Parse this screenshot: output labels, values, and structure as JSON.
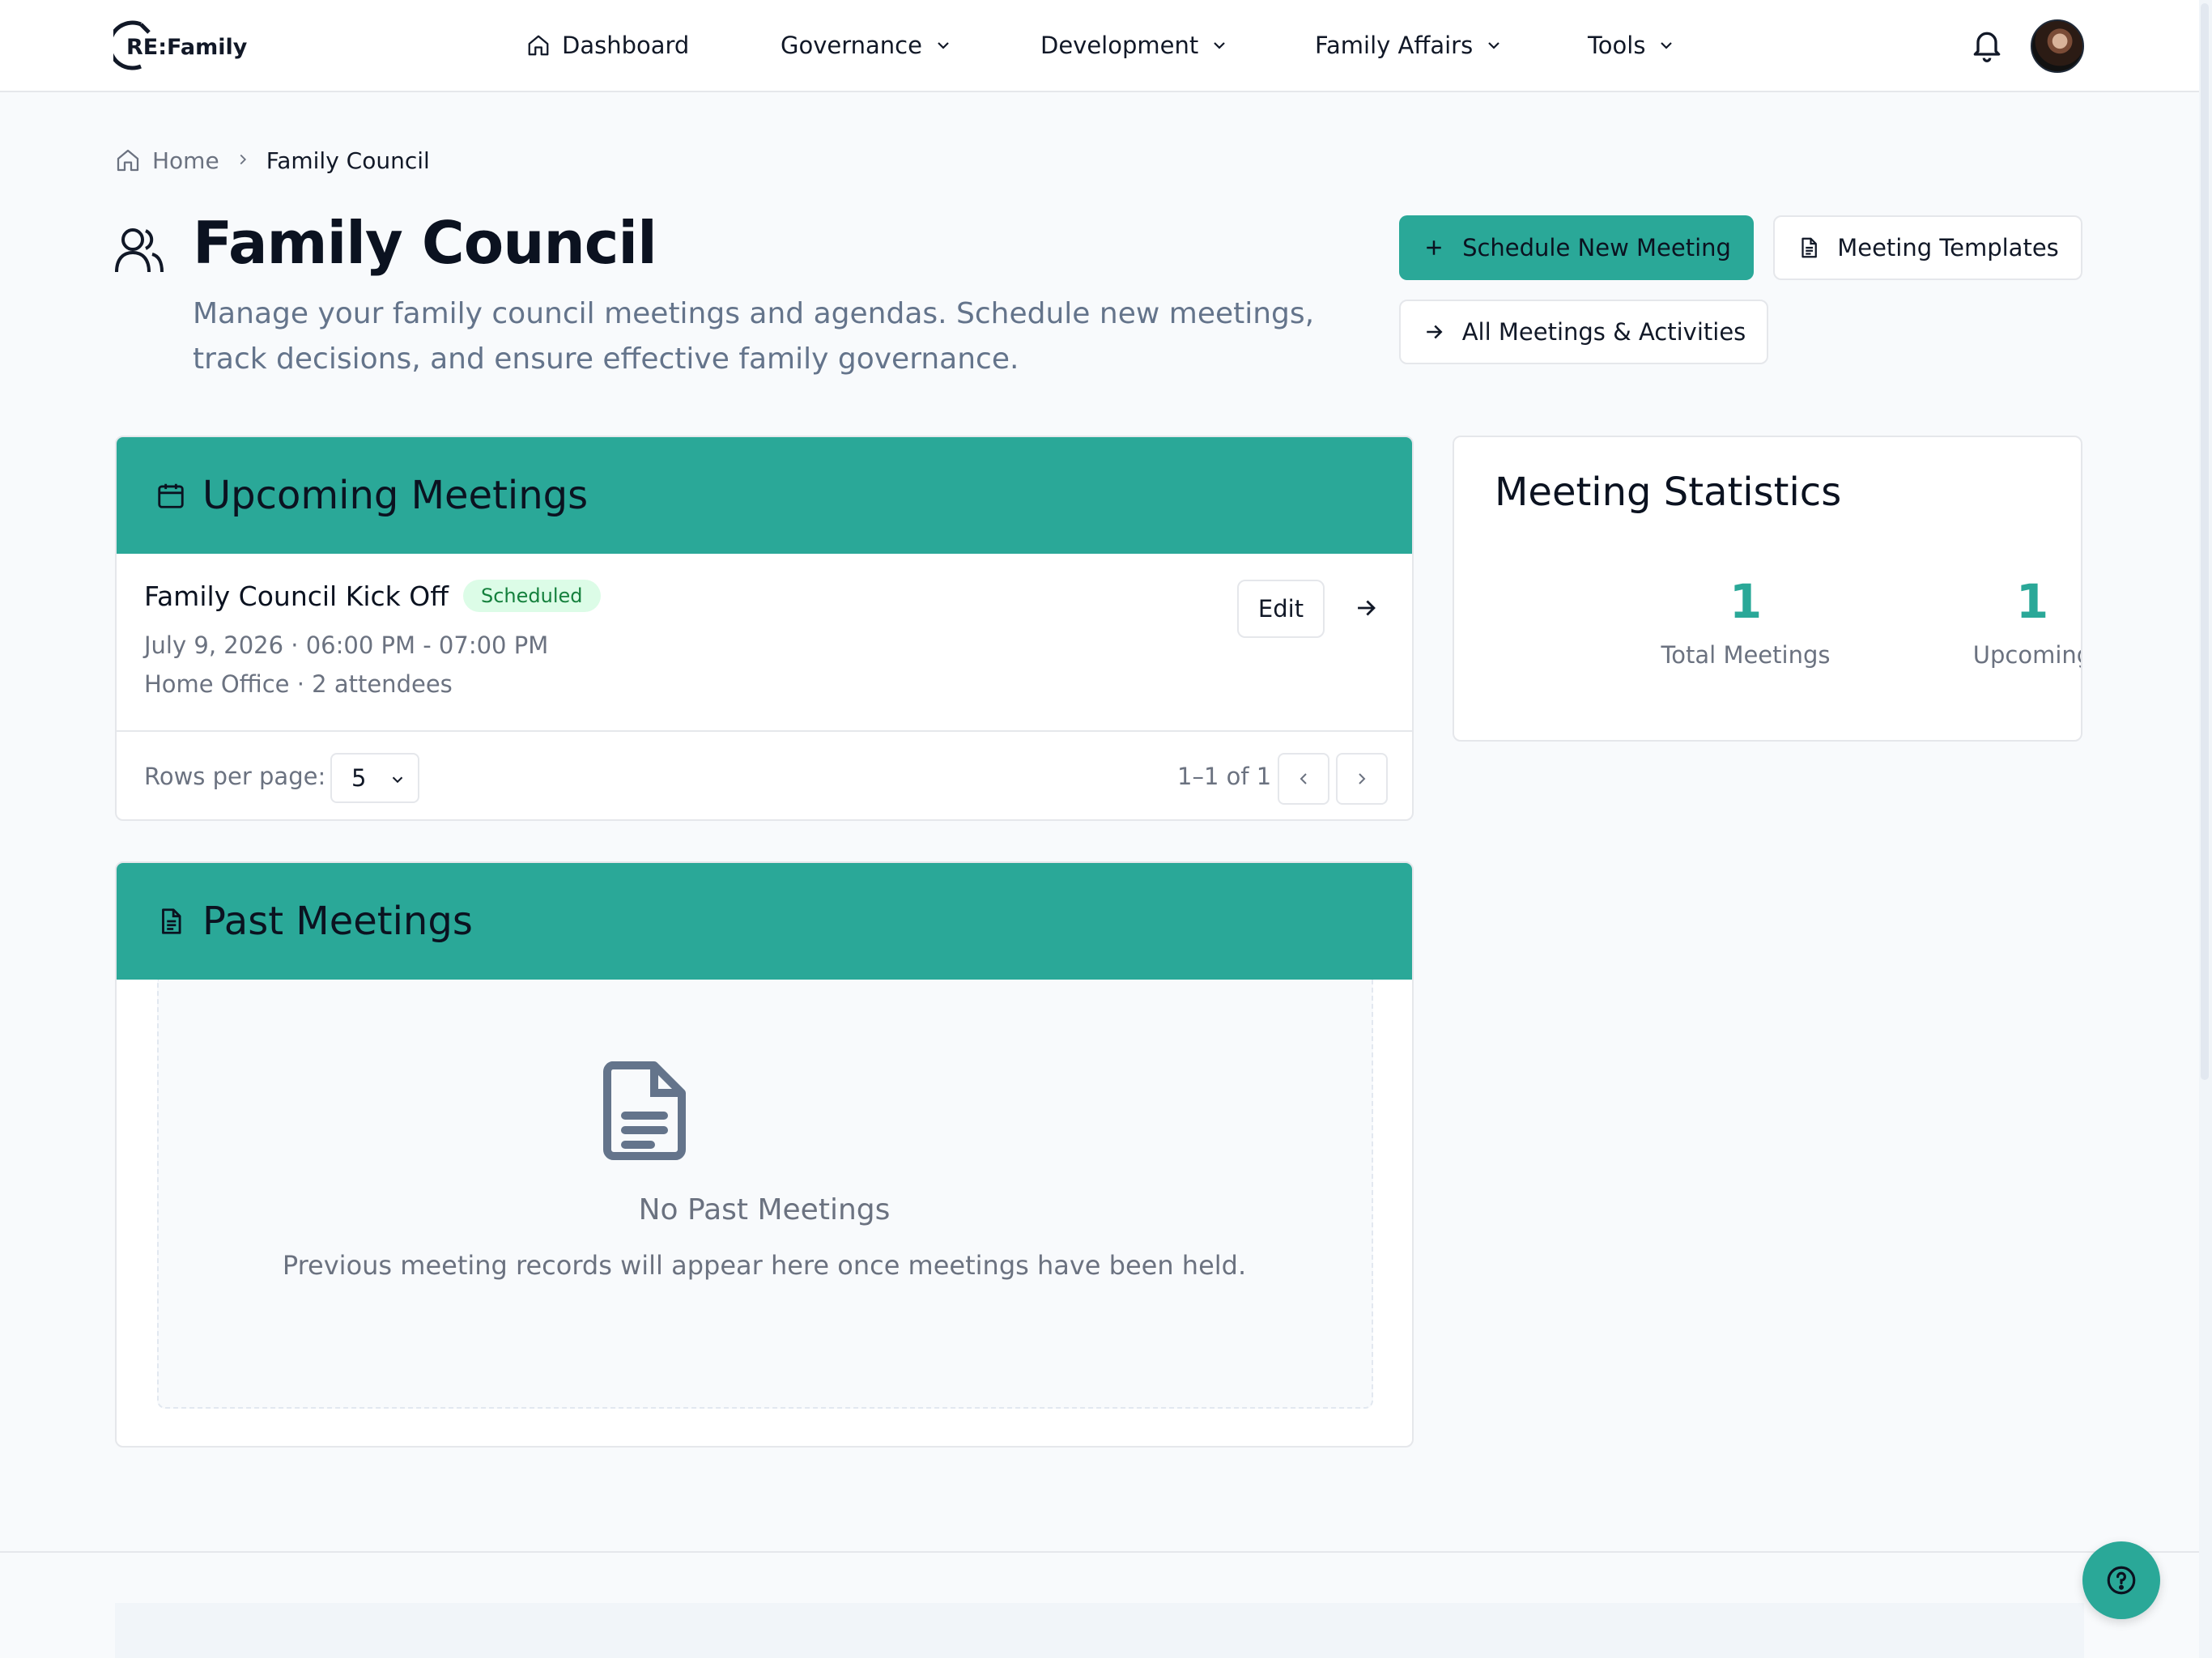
{
  "brand": {
    "logo_text": "RE:Family"
  },
  "nav": {
    "items": [
      {
        "label": "Dashboard"
      },
      {
        "label": "Governance"
      },
      {
        "label": "Development"
      },
      {
        "label": "Family Affairs"
      },
      {
        "label": "Tools"
      }
    ]
  },
  "breadcrumb": {
    "home": "Home",
    "current": "Family Council"
  },
  "header": {
    "title": "Family Council",
    "subtitle": "Manage your family council meetings and agendas. Schedule new meetings, track decisions, and ensure effective family governance."
  },
  "actions": {
    "schedule": "Schedule New Meeting",
    "templates": "Meeting Templates",
    "all": "All Meetings & Activities"
  },
  "upcoming": {
    "title": "Upcoming Meetings",
    "meetings": [
      {
        "title": "Family Council Kick Off",
        "status": "Scheduled",
        "datetime": "July 9, 2026 · 06:00 PM - 07:00 PM",
        "location": "Home Office · 2 attendees",
        "edit_label": "Edit"
      }
    ],
    "pager": {
      "rows_label": "Rows per page:",
      "rows_value": "5",
      "range": "1–1 of 1"
    }
  },
  "past": {
    "title": "Past Meetings",
    "empty_title": "No Past Meetings",
    "empty_desc": "Previous meeting records will appear here once meetings have been held."
  },
  "stats": {
    "title": "Meeting Statistics",
    "total_value": "1",
    "total_label": "Total Meetings",
    "upcoming_value": "1",
    "upcoming_label": "Upcoming"
  },
  "colors": {
    "accent": "#2aa898",
    "badge_bg": "#dcfce7",
    "badge_text": "#15803d"
  },
  "icons": {
    "nav_dashboard": "home-icon",
    "notifications": "bell-icon",
    "title": "users-icon",
    "upcoming": "calendar-icon",
    "past": "document-icon",
    "help": "help-icon"
  }
}
